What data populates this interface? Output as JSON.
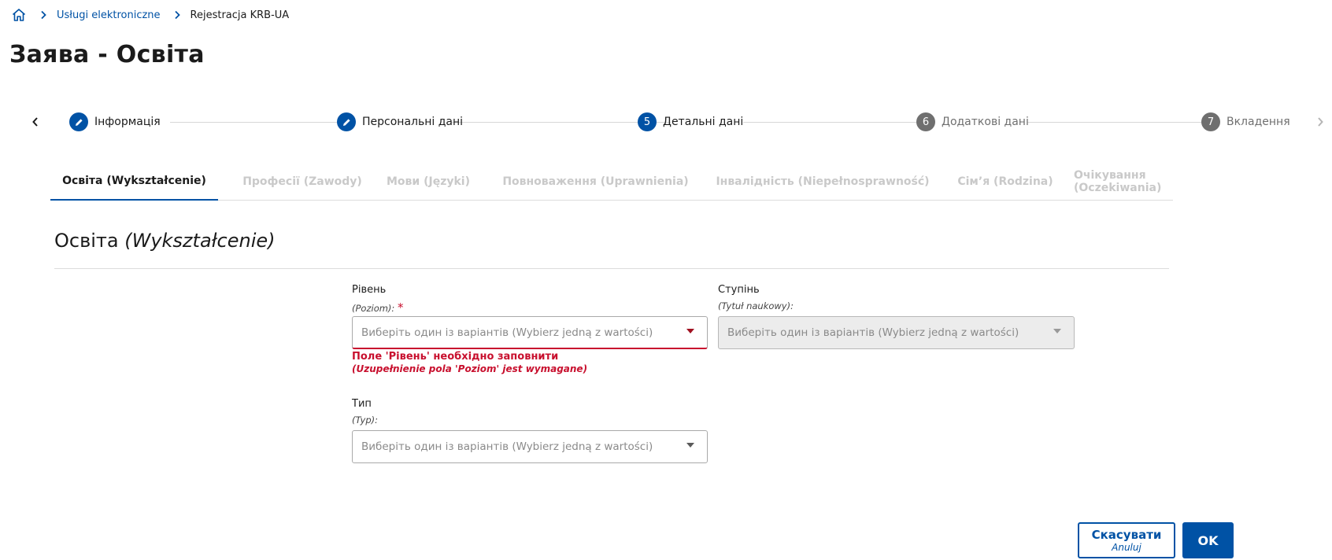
{
  "breadcrumb": {
    "home_icon": "home-icon",
    "link": "Usługi elektroniczne",
    "current": "Rejestracja KRB-UA"
  },
  "page": {
    "title": "Заява - Освіта"
  },
  "stepper": {
    "steps": [
      {
        "marker": "edit-icon",
        "label": "Інформація",
        "state": "done"
      },
      {
        "marker": "edit-icon",
        "label": "Персональні дані",
        "state": "done"
      },
      {
        "marker": "5",
        "label": "Детальні дані",
        "state": "current"
      },
      {
        "marker": "6",
        "label": "Додаткові дані",
        "state": "pending"
      },
      {
        "marker": "7",
        "label": "Вкладення",
        "state": "pending"
      }
    ]
  },
  "tabs": [
    {
      "label": "Освіта (Wykształcenie)",
      "active": true
    },
    {
      "label": "Професії (Zawody)",
      "active": false
    },
    {
      "label": "Мови (Języki)",
      "active": false
    },
    {
      "label": "Повноваження (Uprawnienia)",
      "active": false
    },
    {
      "label": "Інвалідність (Niepełnosprawność)",
      "active": false
    },
    {
      "label": "Сім’я (Rodzina)",
      "active": false
    },
    {
      "label": "Очікування (Oczekiwania)",
      "active": false
    }
  ],
  "section": {
    "title_uk": "Освіта",
    "title_pl": "(Wykształcenie)"
  },
  "form": {
    "level": {
      "label": "Рівень",
      "sublabel": "(Poziom):",
      "required_mark": "*",
      "placeholder": "Виберіть один із варіантів (Wybierz jedną z wartości)",
      "error": "Поле 'Рівень' необхідно заповнити",
      "error_sub": "(Uzupełnienie pola 'Poziom' jest wymagane)"
    },
    "degree": {
      "label": "Ступінь",
      "sublabel": "(Tytuł naukowy):",
      "placeholder": "Виберіть один із варіантів (Wybierz jedną z wartości)",
      "disabled": true
    },
    "type": {
      "label": "Тип",
      "sublabel": "(Typ):",
      "placeholder": "Виберіть один із варіантів (Wybierz jedną z wartości)"
    }
  },
  "buttons": {
    "cancel": "Скасувати",
    "cancel_sub": "Anuluj",
    "ok": "OK"
  },
  "colors": {
    "primary": "#0052a5",
    "error": "#c8102e",
    "step_pending": "#6f6f6f"
  }
}
